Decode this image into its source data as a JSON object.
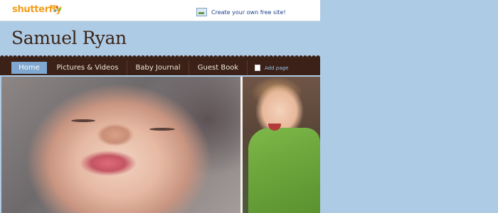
{
  "brand": {
    "logo_text": "shutterfly",
    "logo_color": "#f39c1a"
  },
  "topbar": {
    "promo_icon": "site-icon",
    "promo_label": "Create your own free site!"
  },
  "header": {
    "title": "Samuel Ryan"
  },
  "nav": {
    "tabs": [
      {
        "label": "Home",
        "active": true
      },
      {
        "label": "Pictures & Videos",
        "active": false
      },
      {
        "label": "Baby Journal",
        "active": false
      },
      {
        "label": "Guest Book",
        "active": false
      }
    ],
    "add_page_icon": "page-icon",
    "add_page_label": "Add page"
  },
  "colors": {
    "background": "#aecbe6",
    "nav_bg": "#3b2117",
    "active_tab": "#7fa7cf",
    "title_color": "#3a2416"
  }
}
